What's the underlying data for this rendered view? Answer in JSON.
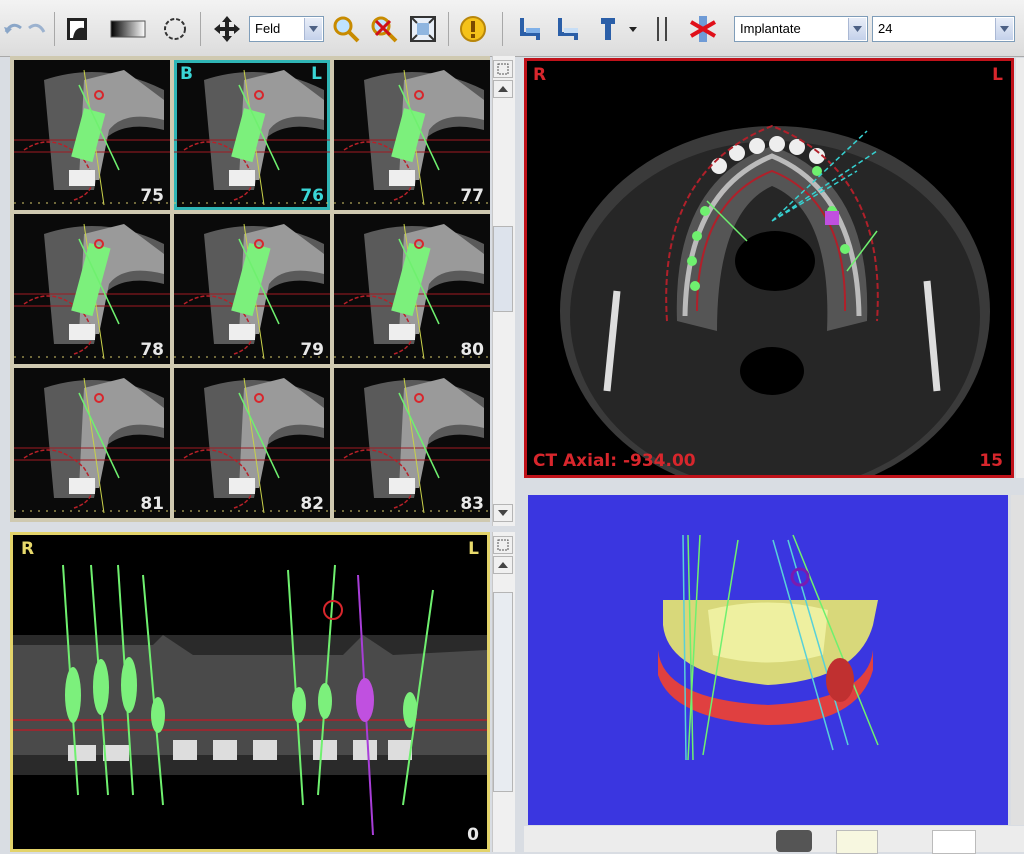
{
  "toolbar": {
    "zoom_select": {
      "value": "Feld",
      "options": [
        "Feld"
      ]
    },
    "object_select": {
      "value": "Implantate"
    },
    "number_select": {
      "value": "24"
    }
  },
  "cross_sections": {
    "orientation_labels": {
      "buccal": "B",
      "lingual": "L"
    },
    "selected_slice": "76",
    "slices": [
      "75",
      "76",
      "77",
      "78",
      "79",
      "80",
      "81",
      "82",
      "83"
    ]
  },
  "axial_view": {
    "label_right": "R",
    "label_left": "L",
    "status": "CT Axial: -934.00",
    "slice": "15"
  },
  "panoramic_view": {
    "label_right": "R",
    "label_left": "L",
    "corner_value": "0"
  },
  "view_3d": {
    "background": "#3a36e0"
  },
  "colors": {
    "implant": "#7cf07c",
    "nerve_outline": "#c0262c",
    "axial_border": "#c0121a",
    "selected_border": "#2fb5b5",
    "pano_border": "#e3d36a"
  }
}
